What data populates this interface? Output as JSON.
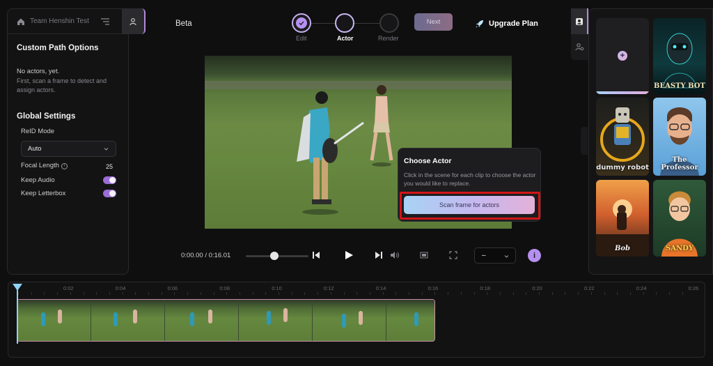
{
  "workspace": {
    "name": "Team Henshin Test"
  },
  "left_panel": {
    "custom_path_heading": "Custom Path Options",
    "no_actors_title": "No actors, yet.",
    "no_actors_desc": "First, scan a frame to detect and assign actors.",
    "global_settings_heading": "Global Settings",
    "reid_mode_label": "ReID Mode",
    "reid_mode_value": "Auto",
    "focal_length_label": "Focal Length",
    "focal_length_value": "25",
    "keep_audio_label": "Keep Audio",
    "keep_audio_on": true,
    "keep_letterbox_label": "Keep Letterbox",
    "keep_letterbox_on": true
  },
  "header": {
    "beta_label": "Beta",
    "steps": [
      {
        "label": "Edit",
        "state": "done"
      },
      {
        "label": "Actor",
        "state": "active"
      },
      {
        "label": "Render",
        "state": "pending"
      }
    ],
    "next_label": "Next",
    "upgrade_label": "Upgrade Plan"
  },
  "popup": {
    "title": "Choose Actor",
    "description": "Click in the scene for each clip to choose the actor you would like to replace.",
    "scan_button_label": "Scan frame for actors"
  },
  "player": {
    "time_readout": "0:00.00 / 0:16.01",
    "speed_value": "–"
  },
  "gallery": {
    "tiles": [
      {
        "caption": "BEASTY BOT",
        "icon": "robot-avatar"
      },
      {
        "caption": "dummy robot",
        "icon": "robot-avatar"
      },
      {
        "caption": "The Professor",
        "icon": "character-avatar"
      },
      {
        "caption": "Bob",
        "icon": "character-avatar"
      },
      {
        "caption": "SANDY",
        "icon": "character-avatar"
      }
    ]
  },
  "timeline": {
    "ticks": [
      "0:02",
      "0:04",
      "0:06",
      "0:08",
      "0:10",
      "0:12",
      "0:14",
      "0:16",
      "0:18",
      "0:20",
      "0:22",
      "0:24",
      "0:26"
    ]
  },
  "colors": {
    "accent_purple": "#b690f0",
    "highlight_red": "#d11616",
    "playhead_blue": "#8fd4f8"
  }
}
